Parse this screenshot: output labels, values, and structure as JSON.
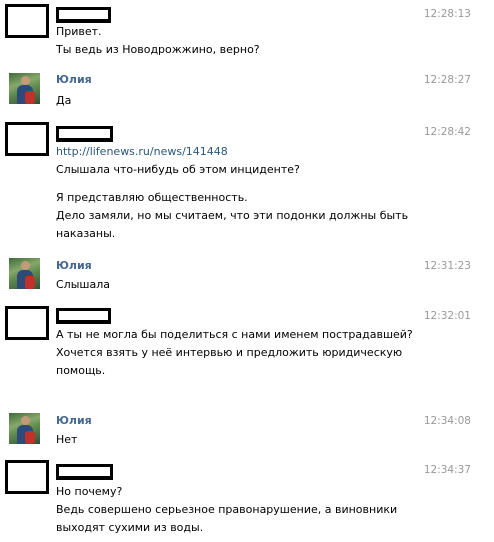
{
  "messages": [
    {
      "time": "12:28:13",
      "lines": [
        "Привет.",
        "Ты ведь из Новодрожжино, верно?"
      ]
    },
    {
      "name": "Юлия",
      "time": "12:28:27",
      "lines": [
        "Да"
      ]
    },
    {
      "time": "12:28:42",
      "link": "http://lifenews.ru/news/141448",
      "lines": [
        "Слышала что-нибудь об этом инциденте?"
      ],
      "lines2": [
        "Я представляю общественность.",
        "Дело замяли, но мы считаем, что эти подонки должны быть",
        "наказаны."
      ]
    },
    {
      "name": "Юлия",
      "time": "12:31:23",
      "lines": [
        "Слышала"
      ]
    },
    {
      "time": "12:32:01",
      "lines": [
        "А ты не могла бы поделиться с нами именем пострадавшей?",
        "Хочется взять у неё интервью и предложить юридическую",
        "помощь."
      ]
    },
    {
      "name": "Юлия",
      "time": "12:34:08",
      "lines": [
        "Нет"
      ]
    },
    {
      "time": "12:34:37",
      "lines": [
        "Но почему?",
        "Ведь совершено серьезное правонарушение, а виновники",
        "выходят сухими из воды."
      ]
    }
  ]
}
